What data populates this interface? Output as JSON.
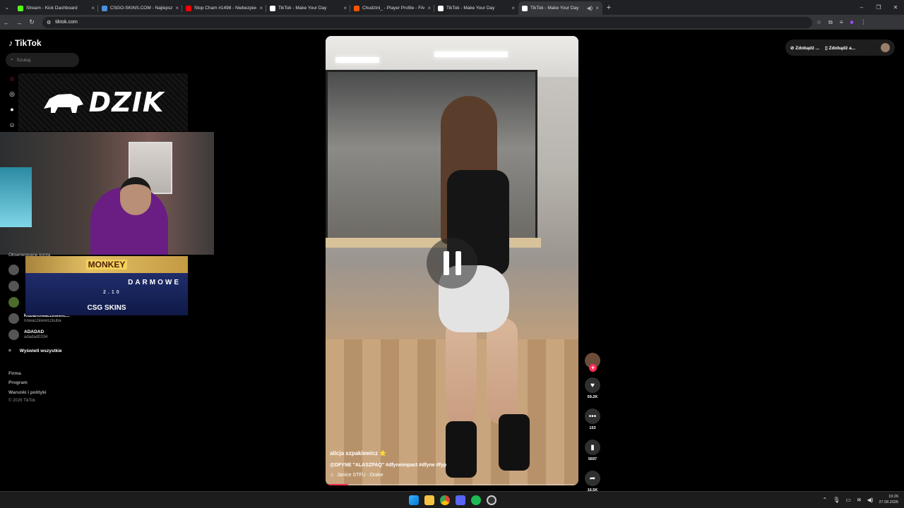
{
  "browser": {
    "tabs": [
      {
        "title": "Stream - Kick Dashboard",
        "color": "#53fc18"
      },
      {
        "title": "CSGO-SKINS.COM - Najlepsze",
        "color": "#4a90e2"
      },
      {
        "title": "Stop Cham #1498 - Niebezpiec",
        "color": "#ff0000"
      },
      {
        "title": "TikTok - Make Your Day",
        "color": "#ffffff"
      },
      {
        "title": "Chudzini_ - Player Profile - FAC",
        "color": "#ff5500"
      },
      {
        "title": "TikTok - Make Your Day",
        "color": "#ffffff"
      },
      {
        "title": "TikTok - Make Your Day",
        "color": "#ffffff"
      }
    ],
    "url": "tiktok.com"
  },
  "tiktok": {
    "logo_text": "TikTok",
    "search_placeholder": "Szukaj",
    "followed_label": "Obserwowane konta",
    "followed": [
      {
        "name": "Kubanowaczkiewic...",
        "handle": "nowaczkiewiczkuba"
      },
      {
        "name": "ADADAD",
        "handle": "adadad0334"
      }
    ],
    "show_all": "Wyświetl wszystkie",
    "footer": [
      "Firma",
      "Program",
      "Warunki i polityki"
    ],
    "copyright": "© 2026 TikTok",
    "top_buttons": [
      "Zdobądź ...",
      "Zdobądź a..."
    ]
  },
  "overlay": {
    "dzik": "DZIK",
    "ad_monkey": "MONKEY",
    "ad_darmowe": "DARMOWE",
    "ad_version": "2.10",
    "ad_brand": "CSG SKINS"
  },
  "video": {
    "author": "alicja szpakiewicz ⭐",
    "caption": "@DFYNE \"ALASZPAQ\" #dfyneimpact #dfyne #fyp",
    "music": "Janice STFU - Drake",
    "progress": 0.09,
    "likes": "59.2K",
    "comments": "153",
    "saves": "5697",
    "shares": "16.5K"
  },
  "taskbar": {
    "time": "19:26",
    "date": "27.08.2026"
  }
}
